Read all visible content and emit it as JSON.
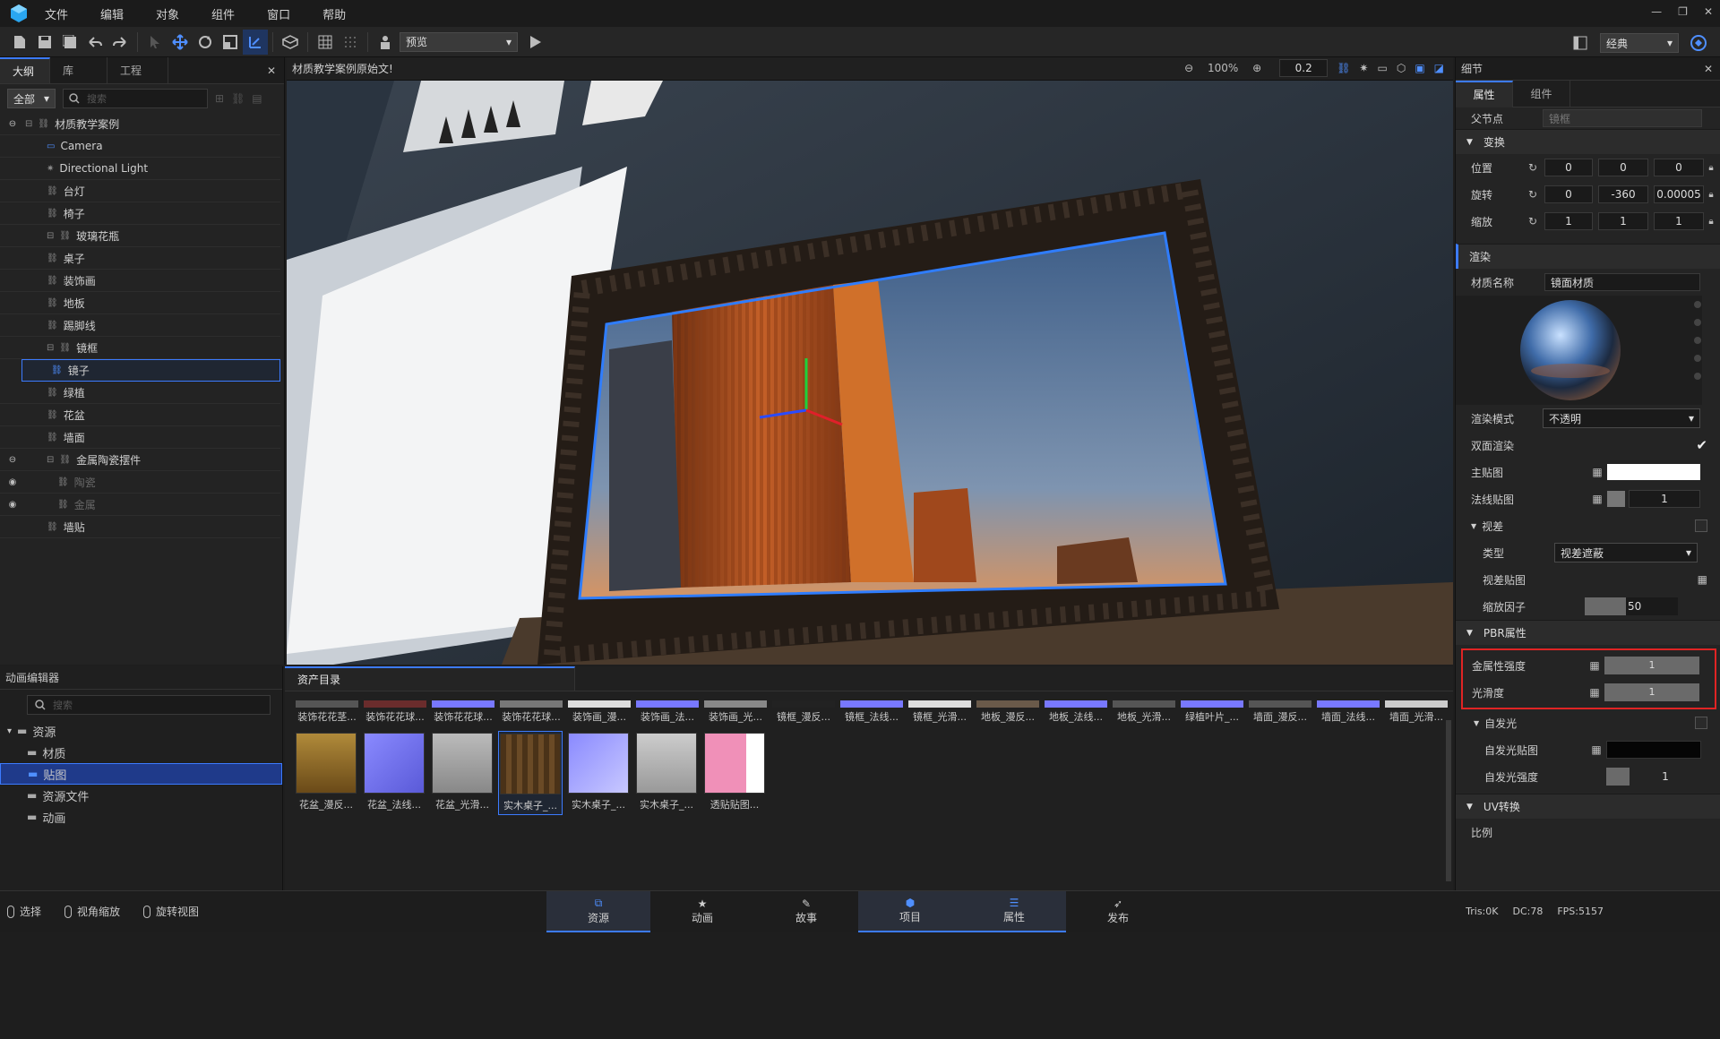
{
  "menu": [
    "文件",
    "编辑",
    "对象",
    "组件",
    "窗口",
    "帮助"
  ],
  "toolbar": {
    "mode_value": "预览",
    "layout_value": "经典"
  },
  "outline": {
    "tabs": [
      "大纲",
      "库",
      "工程"
    ],
    "filter_value": "全部",
    "search_placeholder": "搜索",
    "items": [
      {
        "label": "材质教学案例",
        "level": 0
      },
      {
        "label": "Camera",
        "level": 1
      },
      {
        "label": "Directional Light",
        "level": 1
      },
      {
        "label": "台灯",
        "level": 1
      },
      {
        "label": "椅子",
        "level": 1
      },
      {
        "label": "玻璃花瓶",
        "level": 1
      },
      {
        "label": "桌子",
        "level": 1
      },
      {
        "label": "装饰画",
        "level": 1
      },
      {
        "label": "地板",
        "level": 1
      },
      {
        "label": "踢脚线",
        "level": 1
      },
      {
        "label": "镜框",
        "level": 1
      },
      {
        "label": "镜子",
        "level": 2
      },
      {
        "label": "绿植",
        "level": 1
      },
      {
        "label": "花盆",
        "level": 1
      },
      {
        "label": "墙面",
        "level": 1
      },
      {
        "label": "金属陶瓷摆件",
        "level": 1
      },
      {
        "label": "陶瓷",
        "level": 2
      },
      {
        "label": "金属",
        "level": 2
      },
      {
        "label": "墙贴",
        "level": 1
      }
    ]
  },
  "viewport": {
    "title": "材质教学案例原始文!",
    "zoom": "100%",
    "step": "0.2"
  },
  "details": {
    "header": "细节",
    "tabs": [
      "属性",
      "组件"
    ],
    "parent_label": "父节点",
    "parent_value": "镜框",
    "transform": {
      "title": "变换",
      "position_label": "位置",
      "position": [
        "0",
        "0",
        "0"
      ],
      "rotation_label": "旋转",
      "rotation": [
        "0",
        "-360",
        "0.00005"
      ],
      "scale_label": "缩放",
      "scale": [
        "1",
        "1",
        "1"
      ]
    },
    "render": {
      "title": "渲染",
      "material_label": "材质名称",
      "material_value": "镜面材质",
      "mode_label": "渲染模式",
      "mode_value": "不透明",
      "double_label": "双面渲染",
      "main_tex_label": "主贴图",
      "normal_label": "法线贴图",
      "normal_value": "1",
      "parallax_title": "视差",
      "type_label": "类型",
      "type_value": "视差遮蔽",
      "parallax_tex_label": "视差贴图",
      "scale_factor_label": "缩放因子",
      "scale_factor_value": "50"
    },
    "pbr": {
      "title": "PBR属性",
      "metal_label": "金属性强度",
      "metal_value": "1",
      "smooth_label": "光滑度",
      "smooth_value": "1"
    },
    "emissive": {
      "title": "自发光",
      "tex_label": "自发光贴图",
      "strength_label": "自发光强度",
      "strength_value": "1"
    },
    "uv": {
      "title": "UV转换",
      "ratio_label": "比例"
    }
  },
  "anim_editor": {
    "title": "动画编辑器",
    "search_placeholder": "搜索",
    "tree": [
      {
        "label": "资源",
        "level": 0
      },
      {
        "label": "材质",
        "level": 1
      },
      {
        "label": "贴图",
        "level": 1
      },
      {
        "label": "资源文件",
        "level": 1
      },
      {
        "label": "动画",
        "level": 1
      }
    ]
  },
  "assets": {
    "tab": "资产目录",
    "row1": [
      "装饰花花茎...",
      "装饰花花球...",
      "装饰花花球...",
      "装饰花花球...",
      "装饰画_漫...",
      "装饰画_法...",
      "装饰画_光...",
      "镜框_漫反...",
      "镜框_法线...",
      "镜框_光滑...",
      "地板_漫反...",
      "地板_法线...",
      "地板_光滑...",
      "绿植叶片_...",
      "墙面_漫反...",
      "墙面_法线...",
      "墙面_光滑..."
    ],
    "row2": [
      "花盆_漫反...",
      "花盆_法线...",
      "花盆_光滑...",
      "实木桌子_...",
      "实木桌子_...",
      "实木桌子_...",
      "透贴贴图..."
    ]
  },
  "status": {
    "select": "选择",
    "zoom": "视角缩放",
    "rotate": "旋转视图",
    "tris": "Tris:0K",
    "dc": "DC:78",
    "fps": "FPS:5157"
  },
  "bottom_tabs": [
    "资源",
    "动画",
    "故事",
    "项目",
    "属性",
    "发布"
  ],
  "colors": {
    "accent": "#3c7bff",
    "highlight": "#e02424"
  }
}
